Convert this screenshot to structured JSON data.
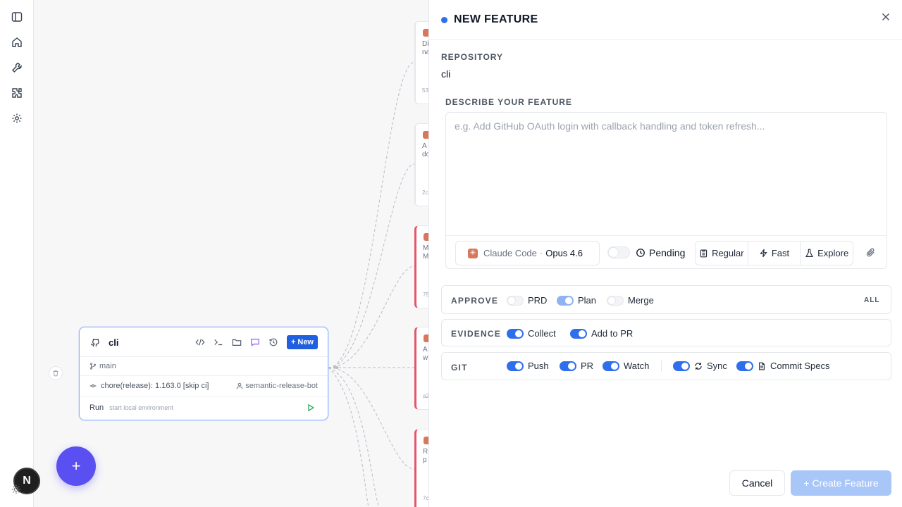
{
  "sidebar": {
    "items": [
      "sidebar-toggle",
      "home",
      "tools",
      "extensions",
      "settings"
    ]
  },
  "canvas": {
    "repo_node": {
      "name": "cli",
      "new_button": "New",
      "branch": "main",
      "commit_message": "chore(release): 1.163.0 [skip ci]",
      "commit_author": "semantic-release-bot",
      "run_label": "Run",
      "run_hint": "start local environment"
    },
    "feature_cards": [
      {
        "text1": "Di",
        "text2": "na",
        "foot": "53",
        "error": false
      },
      {
        "text1": "A",
        "text2": "do",
        "foot": "2c",
        "error": false
      },
      {
        "text1": "M",
        "text2": "M",
        "foot": "75",
        "error": true
      },
      {
        "text1": "A",
        "text2": "w",
        "foot": "a2",
        "error": true
      },
      {
        "text1": "R",
        "text2": "p",
        "foot": "7c",
        "error": true
      }
    ],
    "avatar_letter": "N"
  },
  "panel": {
    "title": "NEW FEATURE",
    "repository_label": "REPOSITORY",
    "repository_value": "cli",
    "describe_label": "DESCRIBE YOUR FEATURE",
    "describe_placeholder": "e.g. Add GitHub OAuth login with callback handling and token refresh...",
    "agent": "Claude Code",
    "model_sep": "·",
    "model": "Opus 4.6",
    "pending_label": "Pending",
    "modes": [
      "Regular",
      "Fast",
      "Explore"
    ],
    "approve": {
      "label": "APPROVE",
      "options": [
        {
          "name": "PRD",
          "on": false
        },
        {
          "name": "Plan",
          "on": true
        },
        {
          "name": "Merge",
          "on": false
        }
      ],
      "all_label": "ALL"
    },
    "evidence": {
      "label": "EVIDENCE",
      "options": [
        {
          "name": "Collect",
          "on": true
        },
        {
          "name": "Add to PR",
          "on": true
        }
      ]
    },
    "git": {
      "label": "GIT",
      "options": [
        {
          "name": "Push",
          "on": true
        },
        {
          "name": "PR",
          "on": true
        },
        {
          "name": "Watch",
          "on": true
        },
        {
          "name": "Sync",
          "on": true
        },
        {
          "name": "Commit Specs",
          "on": true
        }
      ]
    },
    "cancel_label": "Cancel",
    "create_label": "+ Create Feature"
  },
  "colors": {
    "accent": "#2f6fed",
    "fab": "#5a4ff0",
    "create_disabled": "#a8c6f7",
    "error_border": "#e0566b",
    "claude": "#d9775a"
  }
}
